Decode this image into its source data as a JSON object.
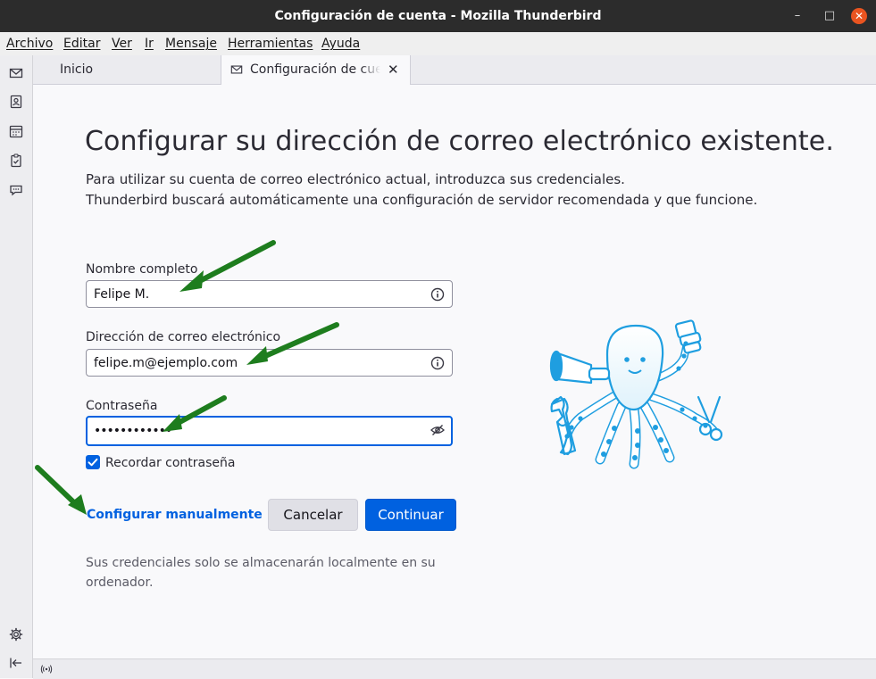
{
  "window": {
    "title": "Configuración de cuenta - Mozilla Thunderbird",
    "close_glyph": "✕",
    "max_glyph": "□",
    "min_glyph": "–"
  },
  "menubar": {
    "items": [
      "Archivo",
      "Editar",
      "Ver",
      "Ir",
      "Mensaje",
      "Herramientas",
      "Ayuda"
    ]
  },
  "tabs": [
    {
      "label": "Inicio"
    },
    {
      "label": "Configuración de cuenta",
      "close_glyph": "✕"
    }
  ],
  "page": {
    "title": "Configurar su dirección de correo electrónico existente.",
    "intro_line1": "Para utilizar su cuenta de correo electrónico actual, introduzca sus credenciales.",
    "intro_line2": "Thunderbird buscará automáticamente una configuración de servidor recomendada y que funcione."
  },
  "form": {
    "name_label": "Nombre completo",
    "name_value": "Felipe M.",
    "email_label": "Dirección de correo electrónico",
    "email_value": "felipe.m@ejemplo.com",
    "password_label": "Contraseña",
    "password_value": "••••••••••••",
    "remember_label": "Recordar contraseña",
    "remember_checked": true
  },
  "actions": {
    "manual_label": "Configurar manualmente",
    "cancel_label": "Cancelar",
    "continue_label": "Continuar"
  },
  "footer": {
    "note": "Sus credenciales solo se almacenarán localmente en su ordenador."
  },
  "colors": {
    "accent": "#0061e0",
    "annotation_arrow": "#1e7d1e",
    "titlebar": "#2c2c2c",
    "close_button": "#e95420"
  },
  "icons": {
    "spaces": [
      "mail-icon",
      "address-book-icon",
      "calendar-icon",
      "tasks-icon",
      "chat-icon"
    ],
    "bottom": [
      "settings-gear-icon",
      "collapse-sidebar-icon"
    ],
    "status": "online-status-icon"
  }
}
